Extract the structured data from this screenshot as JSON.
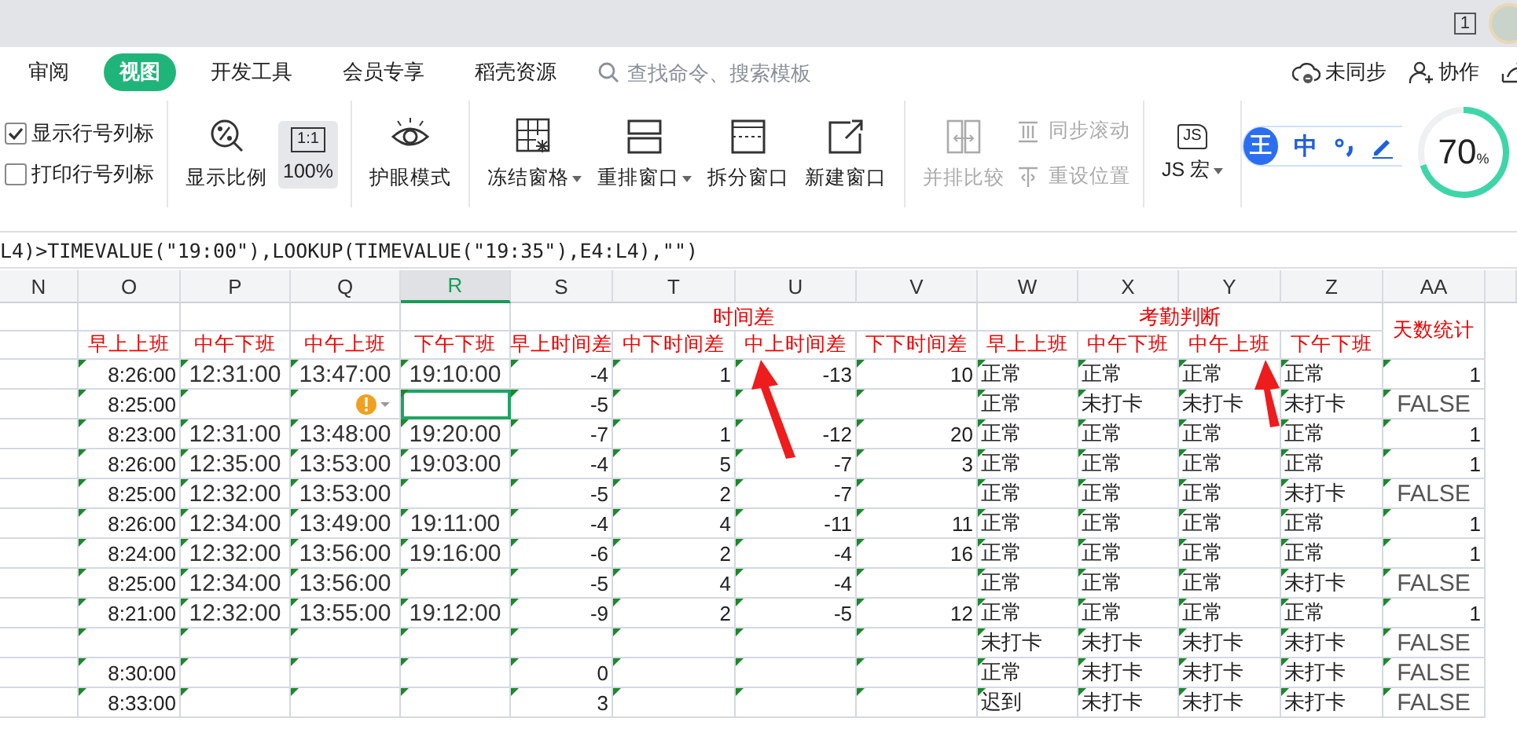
{
  "title_bar": {
    "window_count": "1"
  },
  "tabs": [
    {
      "label": "审阅",
      "selected": false
    },
    {
      "label": "视图",
      "selected": true
    },
    {
      "label": "开发工具",
      "selected": false
    },
    {
      "label": "会员专享",
      "selected": false
    },
    {
      "label": "稻壳资源",
      "selected": false
    }
  ],
  "search": {
    "placeholder": "查找命令、搜索模板"
  },
  "actions": [
    {
      "label": "未同步"
    },
    {
      "label": "协作"
    }
  ],
  "ribbon": {
    "groups": [
      [
        {
          "kind": "checkbox",
          "label": "显示行号列标",
          "checked": true
        },
        {
          "kind": "checkbox",
          "label": "打印行号列标",
          "checked": false
        }
      ],
      [
        {
          "kind": "large",
          "label": "显示比例",
          "selected": false,
          "disabled": false,
          "dropdown": false
        },
        {
          "kind": "large",
          "label": "100%",
          "icon_text": "1:1",
          "selected": true,
          "disabled": false,
          "dropdown": false
        }
      ],
      [
        {
          "kind": "large",
          "label": "护眼模式",
          "selected": false,
          "disabled": false,
          "dropdown": false
        }
      ],
      [
        {
          "kind": "large",
          "label": "冻结窗格",
          "selected": false,
          "disabled": false,
          "dropdown": true
        },
        {
          "kind": "large",
          "label": "重排窗口",
          "selected": false,
          "disabled": false,
          "dropdown": true
        },
        {
          "kind": "large",
          "label": "拆分窗口",
          "selected": false,
          "disabled": false,
          "dropdown": false
        },
        {
          "kind": "large",
          "label": "新建窗口",
          "selected": false,
          "disabled": false,
          "dropdown": false
        }
      ],
      [
        {
          "kind": "large",
          "label": "并排比较",
          "selected": false,
          "disabled": true,
          "dropdown": false
        },
        {
          "kind": "small",
          "label": "同步滚动",
          "disabled": true
        },
        {
          "kind": "small",
          "label": "重设位置",
          "disabled": true
        }
      ],
      [
        {
          "kind": "large",
          "label": "JS 宏",
          "icon_text": "JS",
          "selected": false,
          "disabled": false,
          "dropdown": true
        }
      ]
    ]
  },
  "ime": {
    "logo": "王",
    "mode": "中",
    "level": 0.7,
    "reading": "70",
    "unit": "%"
  },
  "formula": "L4)>TIMEVALUE(\"19:00\"),LOOKUP(TIMEVALUE(\"19:35\"),E4:L4),\"\")",
  "sheet": {
    "columns": [
      {
        "label": "N",
        "selected": false,
        "kind": "number"
      },
      {
        "label": "O",
        "selected": false,
        "kind": "number",
        "header": "早上上班"
      },
      {
        "label": "P",
        "selected": false,
        "kind": "time",
        "header": "中午下班"
      },
      {
        "label": "Q",
        "selected": false,
        "kind": "time",
        "header": "中午上班"
      },
      {
        "label": "R",
        "selected": true,
        "kind": "time",
        "header": "下午下班"
      },
      {
        "label": "S",
        "selected": false,
        "kind": "number",
        "header": "早上时间差",
        "group": "时间差"
      },
      {
        "label": "T",
        "selected": false,
        "kind": "number",
        "header": "中下时间差",
        "grouped": true
      },
      {
        "label": "U",
        "selected": false,
        "kind": "number",
        "header": "中上时间差",
        "grouped": true
      },
      {
        "label": "V",
        "selected": false,
        "kind": "number",
        "header": "下下时间差",
        "grouped": true
      },
      {
        "label": "W",
        "selected": false,
        "kind": "text",
        "header": "早上上班",
        "group": "考勤判断"
      },
      {
        "label": "X",
        "selected": false,
        "kind": "text",
        "header": "中午下班",
        "grouped": true
      },
      {
        "label": "Y",
        "selected": false,
        "kind": "text",
        "header": "中午上班",
        "grouped": true
      },
      {
        "label": "Z",
        "selected": false,
        "kind": "text",
        "header": "下午下班",
        "grouped": true
      },
      {
        "label": "AA",
        "selected": false,
        "kind": "number",
        "header": "天数统计",
        "header_merged": true
      }
    ],
    "rows": [
      {
        "warning": false,
        "selected": false,
        "cells": [
          null,
          "8:26:00",
          "12:31:00",
          "13:47:00",
          "19:10:00",
          "-4",
          "1",
          "-13",
          "10",
          "正常",
          "正常",
          "正常",
          "正常",
          "1"
        ]
      },
      {
        "warning": true,
        "selected": true,
        "cells": [
          null,
          "8:25:00",
          null,
          null,
          null,
          "-5",
          null,
          null,
          null,
          "正常",
          "未打卡",
          "未打卡",
          "未打卡",
          "FALSE"
        ]
      },
      {
        "warning": false,
        "selected": false,
        "cells": [
          null,
          "8:23:00",
          "12:31:00",
          "13:48:00",
          "19:20:00",
          "-7",
          "1",
          "-12",
          "20",
          "正常",
          "正常",
          "正常",
          "正常",
          "1"
        ]
      },
      {
        "warning": false,
        "selected": false,
        "cells": [
          null,
          "8:26:00",
          "12:35:00",
          "13:53:00",
          "19:03:00",
          "-4",
          "5",
          "-7",
          "3",
          "正常",
          "正常",
          "正常",
          "正常",
          "1"
        ]
      },
      {
        "warning": false,
        "selected": false,
        "cells": [
          null,
          "8:25:00",
          "12:32:00",
          "13:53:00",
          null,
          "-5",
          "2",
          "-7",
          null,
          "正常",
          "正常",
          "正常",
          "未打卡",
          "FALSE"
        ]
      },
      {
        "warning": false,
        "selected": false,
        "cells": [
          null,
          "8:26:00",
          "12:34:00",
          "13:49:00",
          "19:11:00",
          "-4",
          "4",
          "-11",
          "11",
          "正常",
          "正常",
          "正常",
          "正常",
          "1"
        ]
      },
      {
        "warning": false,
        "selected": false,
        "cells": [
          null,
          "8:24:00",
          "12:32:00",
          "13:56:00",
          "19:16:00",
          "-6",
          "2",
          "-4",
          "16",
          "正常",
          "正常",
          "正常",
          "正常",
          "1"
        ]
      },
      {
        "warning": false,
        "selected": false,
        "cells": [
          null,
          "8:25:00",
          "12:34:00",
          "13:56:00",
          null,
          "-5",
          "4",
          "-4",
          null,
          "正常",
          "正常",
          "正常",
          "未打卡",
          "FALSE"
        ]
      },
      {
        "warning": false,
        "selected": false,
        "cells": [
          null,
          "8:21:00",
          "12:32:00",
          "13:55:00",
          "19:12:00",
          "-9",
          "2",
          "-5",
          "12",
          "正常",
          "正常",
          "正常",
          "正常",
          "1"
        ]
      },
      {
        "warning": false,
        "selected": false,
        "cells": [
          null,
          null,
          null,
          null,
          null,
          null,
          null,
          null,
          null,
          "未打卡",
          "未打卡",
          "未打卡",
          "未打卡",
          "FALSE"
        ]
      },
      {
        "warning": false,
        "selected": false,
        "cells": [
          null,
          "8:30:00",
          null,
          null,
          null,
          "0",
          null,
          null,
          null,
          "正常",
          "未打卡",
          "未打卡",
          "未打卡",
          "FALSE"
        ]
      },
      {
        "warning": false,
        "selected": false,
        "cells": [
          null,
          "8:33:00",
          null,
          null,
          null,
          "3",
          null,
          null,
          null,
          "迟到",
          "未打卡",
          "未打卡",
          "未打卡",
          "FALSE"
        ]
      }
    ]
  }
}
